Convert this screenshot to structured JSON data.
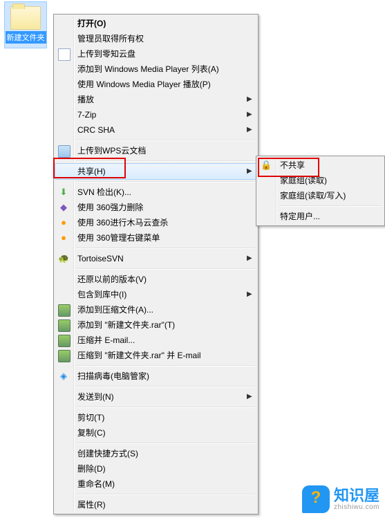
{
  "desktop": {
    "folder_label": "新建文件夹"
  },
  "menu": {
    "open": "打开(O)",
    "admin_own": "管理员取得所有权",
    "upload_cloud": "上传到零知云盘",
    "wmp_add": "添加到 Windows Media Player 列表(A)",
    "wmp_play": "使用 Windows Media Player 播放(P)",
    "play": "播放",
    "sevenzip": "7-Zip",
    "crc": "CRC SHA",
    "wps_upload": "上传到WPS云文档",
    "share": "共享(H)",
    "svn_checkout": "SVN 检出(K)...",
    "del_360": "使用 360强力删除",
    "scan_360": "使用 360进行木马云查杀",
    "manage_360": "使用 360管理右键菜单",
    "tortoise": "TortoiseSVN",
    "restore": "还原以前的版本(V)",
    "library": "包含到库中(I)",
    "rar_add": "添加到压缩文件(A)...",
    "rar_add_name": "添加到 \"新建文件夹.rar\"(T)",
    "rar_email": "压缩并 E-mail...",
    "rar_email_name": "压缩到 \"新建文件夹.rar\" 并 E-mail",
    "virus_scan": "扫描病毒(电脑管家)",
    "send_to": "发送到(N)",
    "cut": "剪切(T)",
    "copy": "复制(C)",
    "shortcut": "创建快捷方式(S)",
    "delete": "删除(D)",
    "rename": "重命名(M)",
    "properties": "属性(R)"
  },
  "submenu": {
    "no_share": "不共享",
    "homegroup_read": "家庭组(读取)",
    "homegroup_rw": "家庭组(读取/写入)",
    "specific_user": "特定用户..."
  },
  "logo": {
    "text": "知识屋",
    "sub": "zhishiwu.com"
  }
}
